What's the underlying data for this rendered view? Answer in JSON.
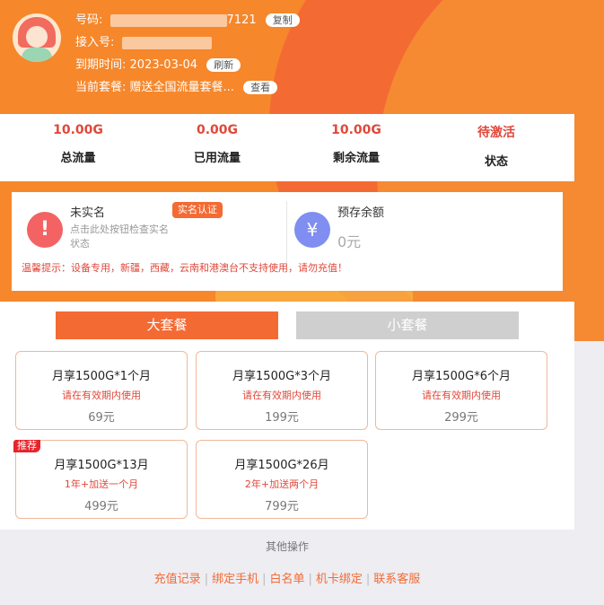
{
  "header": {
    "number_label": "号码:",
    "number_suffix": "7121",
    "copy_label": "复制",
    "access_label": "接入号:",
    "expiry_label": "到期时间:",
    "expiry_date": "2023-03-04",
    "refresh_label": "刷新",
    "plan_label": "当前套餐:",
    "plan_value": "赠送全国流量套餐...",
    "view_label": "查看"
  },
  "stats": [
    {
      "value": "10.00G",
      "label": "总流量"
    },
    {
      "value": "0.00G",
      "label": "已用流量"
    },
    {
      "value": "10.00G",
      "label": "剩余流量"
    },
    {
      "value": "待激活",
      "label": "状态"
    }
  ],
  "account": {
    "unauth_title": "未实名",
    "unauth_sub": "点击此处按钮检查实名状态",
    "auth_button": "实名认证",
    "deposit_title": "预存余额",
    "deposit_value": "0元",
    "yen_icon": "¥",
    "tip": "温馨提示：设备专用，新疆，西藏，云南和港澳台不支持使用，请勿充值！"
  },
  "tabs": {
    "big": "大套餐",
    "small": "小套餐"
  },
  "packages": [
    {
      "title": "月享1500G*1个月",
      "desc": "请在有效期内使用",
      "price": "69元",
      "badge": ""
    },
    {
      "title": "月享1500G*3个月",
      "desc": "请在有效期内使用",
      "price": "199元",
      "badge": ""
    },
    {
      "title": "月享1500G*6个月",
      "desc": "请在有效期内使用",
      "price": "299元",
      "badge": ""
    },
    {
      "title": "月享1500G*13月",
      "desc": "1年+加送一个月",
      "price": "499元",
      "badge": "推荐"
    },
    {
      "title": "月享1500G*26月",
      "desc": "2年+加送两个月",
      "price": "799元",
      "badge": ""
    }
  ],
  "footer": {
    "other_title": "其他操作",
    "links": [
      "充值记录",
      "绑定手机",
      "白名单",
      "机卡绑定",
      "联系客服"
    ]
  }
}
